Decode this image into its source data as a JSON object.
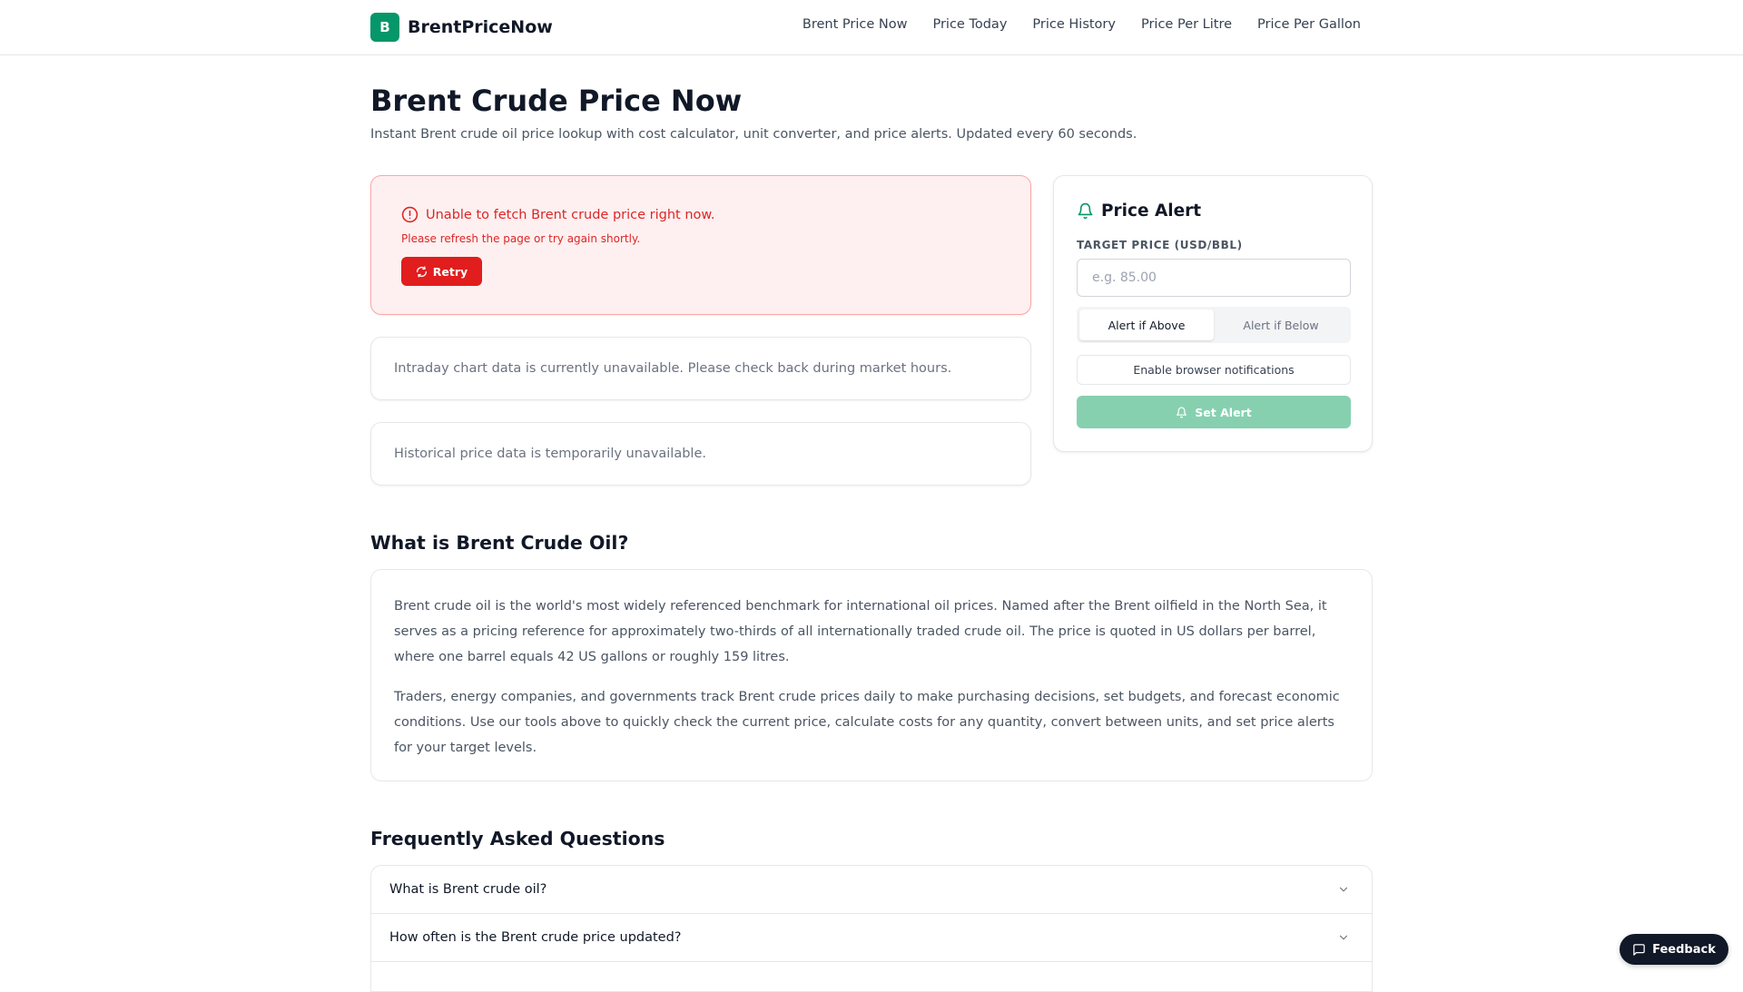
{
  "brand": {
    "logo_letter": "B",
    "name": "BrentPriceNow"
  },
  "nav": {
    "items": [
      {
        "label": "Brent Price Now"
      },
      {
        "label": "Price Today"
      },
      {
        "label": "Price History"
      },
      {
        "label": "Price Per Litre"
      },
      {
        "label": "Price Per Gallon"
      }
    ]
  },
  "page": {
    "title": "Brent Crude Price Now",
    "subtitle": "Instant Brent crude oil price lookup with cost calculator, unit converter, and price alerts. Updated every 60 seconds."
  },
  "error": {
    "icon": "alert-circle-icon",
    "title": "Unable to fetch Brent crude price right now.",
    "subtitle": "Please refresh the page or try again shortly.",
    "retry_label": "Retry",
    "retry_icon": "refresh-icon"
  },
  "intraday": {
    "message": "Intraday chart data is currently unavailable. Please check back during market hours."
  },
  "historical": {
    "message": "Historical price data is temporarily unavailable."
  },
  "alert": {
    "icon": "bell-icon",
    "title": "Price Alert",
    "target_label": "TARGET PRICE (USD/BBL)",
    "target_placeholder": "e.g. 85.00",
    "target_value": "",
    "toggle": {
      "above_label": "Alert if Above",
      "below_label": "Alert if Below",
      "selected": "above"
    },
    "notify_label": "Enable browser notifications",
    "set_label": "Set Alert",
    "set_icon": "bell-icon"
  },
  "about": {
    "title": "What is Brent Crude Oil?",
    "paragraphs": [
      "Brent crude oil is the world's most widely referenced benchmark for international oil prices. Named after the Brent oilfield in the North Sea, it serves as a pricing reference for approximately two-thirds of all internationally traded crude oil. The price is quoted in US dollars per barrel, where one barrel equals 42 US gallons or roughly 159 litres.",
      "Traders, energy companies, and governments track Brent crude prices daily to make purchasing decisions, set budgets, and forecast economic conditions. Use our tools above to quickly check the current price, calculate costs for any quantity, convert between units, and set price alerts for your target levels."
    ]
  },
  "faq": {
    "title": "Frequently Asked Questions",
    "items": [
      {
        "question": "What is Brent crude oil?"
      },
      {
        "question": "How often is the Brent crude price updated?"
      },
      {
        "question": ""
      }
    ]
  },
  "feedback": {
    "label": "Feedback",
    "icon": "message-square-icon"
  },
  "colors": {
    "brand": "#059669",
    "error_red": "#dc2626",
    "error_bg": "#fef0f0",
    "set_alert_disabled": "#86d0b0",
    "feedback_bg": "#111827"
  }
}
